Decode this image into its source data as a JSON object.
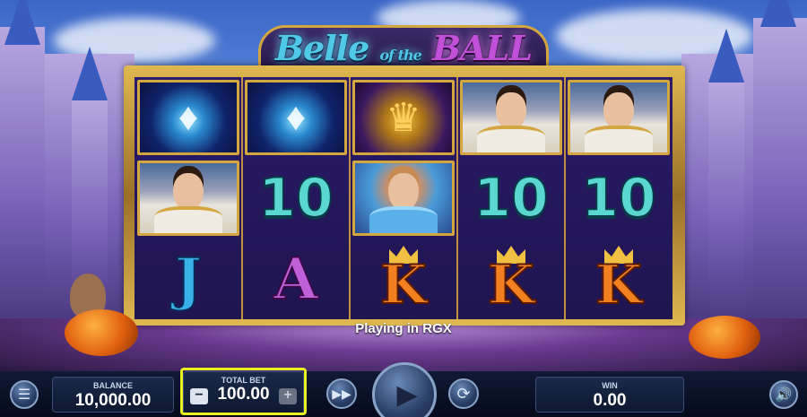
{
  "game": {
    "logo_part1": "Belle",
    "logo_part2": "of the",
    "logo_part3": "BALL",
    "status_text": "Playing in RGX"
  },
  "reels": {
    "rows": [
      [
        "glass-slipper",
        "glass-slipper",
        "golden-coach",
        "prince",
        "prince"
      ],
      [
        "prince",
        "10",
        "princess",
        "10",
        "10"
      ],
      [
        "J",
        "A",
        "K",
        "K",
        "K"
      ]
    ]
  },
  "controls": {
    "balance_label": "BALANCE",
    "balance_value": "10,000.00",
    "total_bet_label": "TOTAL BET",
    "total_bet_value": "100.00",
    "win_label": "WIN",
    "win_value": "0.00",
    "bet_decrease": "−",
    "bet_increase": "+"
  },
  "icons": {
    "menu": "menu-icon",
    "turbo": "fast-forward-icon",
    "spin": "play-icon",
    "autoplay": "autoplay-icon",
    "sound": "speaker-icon"
  },
  "colors": {
    "highlight": "#e8f020",
    "frame_gold": "#d4a640",
    "reel_bg": "#2a1a6a"
  }
}
